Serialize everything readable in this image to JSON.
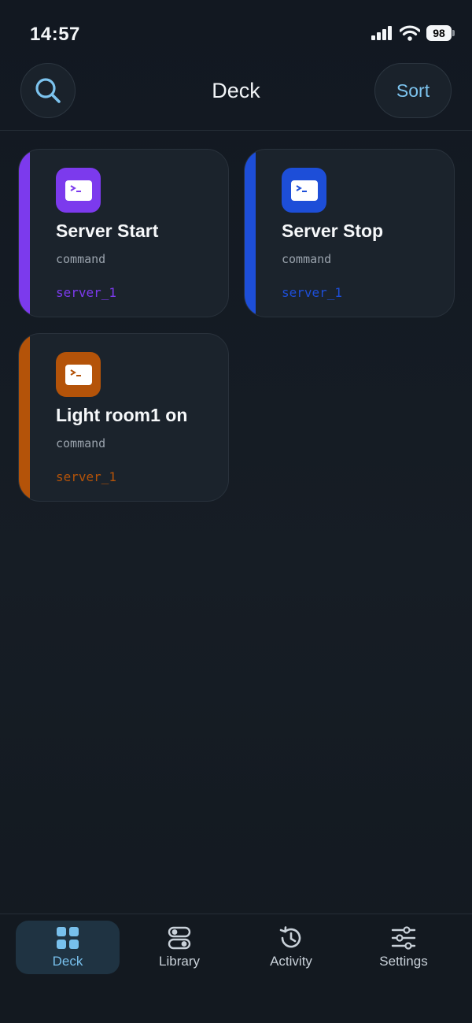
{
  "status_bar": {
    "time": "14:57",
    "battery": "98",
    "signal_icon": "cellular-signal-icon",
    "wifi_icon": "wifi-icon"
  },
  "header": {
    "title": "Deck",
    "sort_label": "Sort",
    "search_icon": "search-icon"
  },
  "cards": [
    {
      "title": "Server Start",
      "type": "command",
      "server": "server_1",
      "accent": "#7c3aed",
      "icon": "terminal-icon"
    },
    {
      "title": "Server Stop",
      "type": "command",
      "server": "server_1",
      "accent": "#1d4ed8",
      "icon": "terminal-icon"
    },
    {
      "title": "Light room1 on",
      "type": "command",
      "server": "server_1",
      "accent": "#b45309",
      "icon": "terminal-icon"
    }
  ],
  "tabs": [
    {
      "label": "Deck",
      "icon": "grid-icon",
      "active": true
    },
    {
      "label": "Library",
      "icon": "toggles-icon",
      "active": false
    },
    {
      "label": "Activity",
      "icon": "history-icon",
      "active": false
    },
    {
      "label": "Settings",
      "icon": "sliders-icon",
      "active": false
    }
  ],
  "colors": {
    "accent_blue": "#78c0ec",
    "background": "#141a21",
    "card": "#1b232c"
  }
}
